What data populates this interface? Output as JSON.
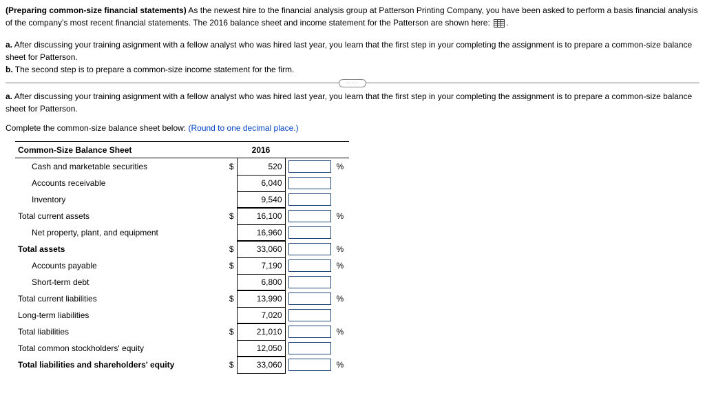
{
  "intro": {
    "title": "(Preparing common-size financial statements)",
    "body1": " As the newest hire to the financial analysis group at Patterson Printing Company, you have been asked to perform a basis financial analysis of the company's most recent financial statements. The 2016 balance sheet and income statement for the Patterson are shown here: ",
    "period": "."
  },
  "list": {
    "a_bold": "a.",
    "a_text": " After discussing your training asignment with a fellow analyst who was hired last year, you learn that the first step in your completing the assignment is to prepare a common-size balance sheet for Patterson.",
    "b_bold": "b.",
    "b_text": " The second step is to prepare a common-size income statement for the firm."
  },
  "notch": "·····",
  "subprompt": {
    "a_bold": "a.",
    "a_text": " After discussing your training asignment with a fellow analyst who was hired last year, you learn that the first step in your completing the assignment is to prepare a common-size balance sheet for Patterson."
  },
  "instruction": {
    "prefix": "Complete the common-size balance sheet below:  ",
    "hint": "(Round to one decimal place.)"
  },
  "sheet": {
    "header_left": "Common-Size Balance Sheet",
    "header_year": "2016",
    "dollar": "$",
    "pct": "%",
    "rows": [
      {
        "label": "Cash and marketable securities",
        "indent": true,
        "bold": false,
        "has_dollar": true,
        "value": "520",
        "has_pct": true,
        "underline": false
      },
      {
        "label": "Accounts receivable",
        "indent": true,
        "bold": false,
        "has_dollar": false,
        "value": "6,040",
        "has_pct": false,
        "underline": false
      },
      {
        "label": "Inventory",
        "indent": true,
        "bold": false,
        "has_dollar": false,
        "value": "9,540",
        "has_pct": false,
        "underline": true
      },
      {
        "label": "Total current assets",
        "indent": false,
        "bold": false,
        "has_dollar": true,
        "value": "16,100",
        "has_pct": true,
        "underline": false
      },
      {
        "label": "Net property, plant, and equipment",
        "indent": true,
        "bold": false,
        "has_dollar": false,
        "value": "16,960",
        "has_pct": false,
        "underline": true
      },
      {
        "label": "Total assets",
        "indent": false,
        "bold": true,
        "has_dollar": true,
        "value": "33,060",
        "has_pct": true,
        "underline": false
      },
      {
        "label": "Accounts payable",
        "indent": true,
        "bold": false,
        "has_dollar": true,
        "value": "7,190",
        "has_pct": true,
        "underline": false
      },
      {
        "label": "Short-term debt",
        "indent": true,
        "bold": false,
        "has_dollar": false,
        "value": "6,800",
        "has_pct": false,
        "underline": true
      },
      {
        "label": "Total current liabilities",
        "indent": false,
        "bold": false,
        "has_dollar": true,
        "value": "13,990",
        "has_pct": true,
        "underline": false
      },
      {
        "label": "Long-term liabilities",
        "indent": false,
        "bold": false,
        "has_dollar": false,
        "value": "7,020",
        "has_pct": false,
        "underline": true
      },
      {
        "label": "Total liabilities",
        "indent": false,
        "bold": false,
        "has_dollar": true,
        "value": "21,010",
        "has_pct": true,
        "underline": false
      },
      {
        "label": "Total common stockholders' equity",
        "indent": false,
        "bold": false,
        "has_dollar": false,
        "value": "12,050",
        "has_pct": false,
        "underline": true
      },
      {
        "label": "Total liabilities and shareholders' equity",
        "indent": false,
        "bold": true,
        "has_dollar": true,
        "value": "33,060",
        "has_pct": true,
        "underline": false
      }
    ]
  }
}
